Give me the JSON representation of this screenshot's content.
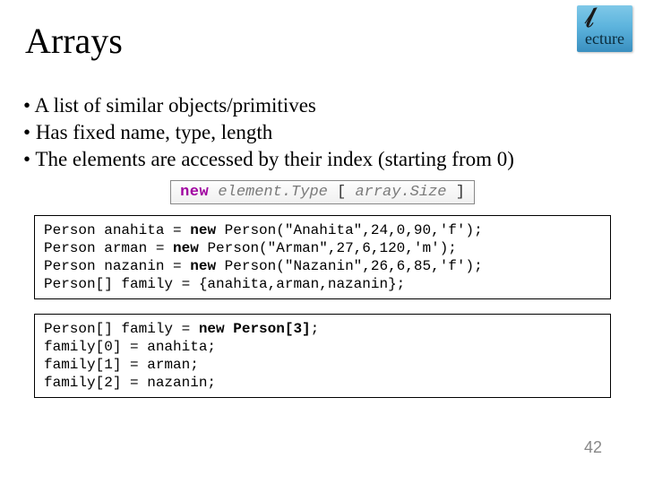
{
  "logo": {
    "cursive_text": "ecture"
  },
  "title": "Arrays",
  "bullets": [
    "A list of similar objects/primitives",
    "Has fixed name, type, length",
    "The elements are accessed by their index (starting from 0)"
  ],
  "syntax": {
    "kw": "new",
    "element_type": "element.Type",
    "open": "[",
    "size": "array.Size",
    "close": "]"
  },
  "code1": {
    "l1a": "Person anahita = ",
    "l1b": "new",
    "l1c": " Person(\"Anahita\",24,0,90,'f');",
    "l2a": "Person arman = ",
    "l2b": "new",
    "l2c": " Person(\"Arman\",27,6,120,'m');",
    "l3a": "Person nazanin = ",
    "l3b": "new",
    "l3c": " Person(\"Nazanin\",26,6,85,'f');",
    "l4": "Person[] family = {anahita,arman,nazanin};"
  },
  "code2": {
    "l1a": "Person[] family = ",
    "l1b": "new Person[3]",
    "l1c": ";",
    "l2": "family[0] = anahita;",
    "l3": "family[1] = arman;",
    "l4": "family[2] = nazanin;"
  },
  "page_number": "42"
}
